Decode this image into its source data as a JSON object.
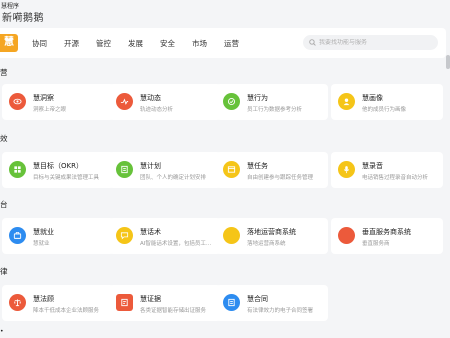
{
  "app": {
    "name": "慧程序",
    "tab_title": "新嗬鹅鹅"
  },
  "logo": {
    "text": "慧"
  },
  "nav": {
    "items": [
      "协同",
      "开源",
      "管控",
      "发展",
      "安全",
      "市场",
      "运营"
    ]
  },
  "search": {
    "placeholder": "我要找功能与服务"
  },
  "sections": [
    {
      "label": "营",
      "cards": [
        {
          "title": "慧洞察",
          "desc": "洞察上帝之眼",
          "color": "#ec5a3b",
          "icon": "eye-icon"
        },
        {
          "title": "慧动态",
          "desc": "轨迹动态分析",
          "color": "#ec5a3b",
          "icon": "activity-icon"
        },
        {
          "title": "慧行为",
          "desc": "员工行为数据参考分析",
          "color": "#67c23a",
          "icon": "behavior-icon"
        },
        {
          "title": "慧画像",
          "desc": "他的成员行为画像",
          "color": "#f5c518",
          "icon": "portrait-icon"
        }
      ]
    },
    {
      "label": "效",
      "cards": [
        {
          "title": "慧目标（OKR）",
          "desc": "目标与关键成果法管理工具",
          "color": "#67c23a",
          "icon": "target-icon"
        },
        {
          "title": "慧计划",
          "desc": "团队、个人的确定计划安排",
          "color": "#67c23a",
          "icon": "plan-icon"
        },
        {
          "title": "慧任务",
          "desc": "自由创建参与跟踪任务管理",
          "color": "#f5c518",
          "icon": "task-icon"
        },
        {
          "title": "慧录音",
          "desc": "电话销售过程录音自动分析",
          "color": "#f5c518",
          "icon": "microphone-icon"
        }
      ]
    },
    {
      "label": "台",
      "cards": [
        {
          "title": "慧就业",
          "desc": "慧就业",
          "color": "#2d8cf0",
          "icon": "employment-icon"
        },
        {
          "title": "慧话术",
          "desc": "AI智能话术设置，包括员工话术",
          "color": "#f5c518",
          "icon": "script-icon"
        },
        {
          "title": "落地运营商系统",
          "desc": "落地运营商系统",
          "color": "#f5c518",
          "icon": "operator-icon"
        },
        {
          "title": "垂直服务商系统",
          "desc": "垂直服务商",
          "color": "#ec5a3b",
          "icon": "vertical-service-icon"
        }
      ]
    },
    {
      "label": "律",
      "cards": [
        {
          "title": "慧法顾",
          "desc": "降本千低成本企业法顾服务",
          "color": "#ec5a3b",
          "icon": "legal-advisor-icon"
        },
        {
          "title": "慧证据",
          "desc": "各类证据智能存储出证服务",
          "color": "#ec5a3b",
          "icon": "evidence-icon"
        },
        {
          "title": "慧合同",
          "desc": "有法律效力的电子合同签署",
          "color": "#2d8cf0",
          "icon": "contract-icon"
        }
      ]
    }
  ],
  "partial_section_label": "•"
}
